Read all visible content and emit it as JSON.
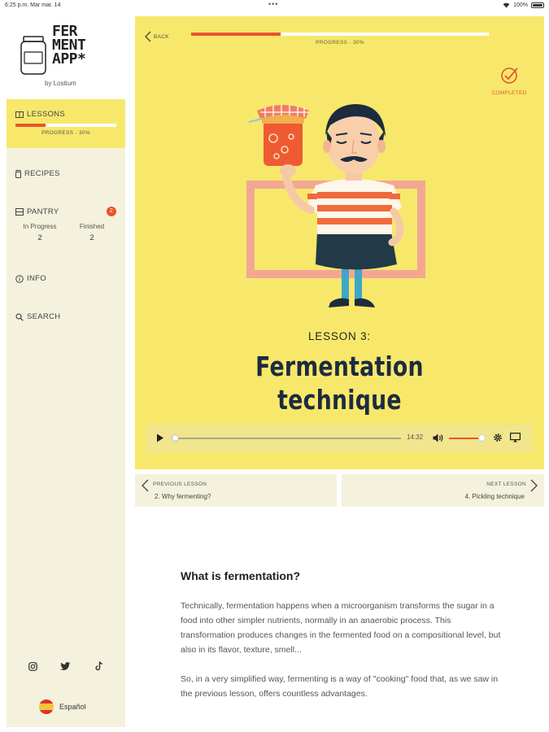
{
  "status_bar": {
    "time_date": "6:25 p.m.   Mar mar. 14",
    "dots": "•••",
    "battery": "100%"
  },
  "brand": {
    "logo_lines": [
      "FER",
      "MENT",
      "APP*"
    ],
    "byline": "by Lostium"
  },
  "sidebar": {
    "lessons": {
      "label": "LESSONS",
      "progress_text": "PROGRESS - 30%",
      "progress": 0.3
    },
    "recipes": {
      "label": "RECIPES"
    },
    "pantry": {
      "label": "PANTRY",
      "badge": "2",
      "in_progress_label": "In Progress",
      "in_progress_value": "2",
      "finished_label": "Finished",
      "finished_value": "2"
    },
    "info": {
      "label": "INFO"
    },
    "search": {
      "label": "SEARCH"
    },
    "socials": [
      "instagram-icon",
      "twitter-icon",
      "tiktok-icon"
    ],
    "language": "Español"
  },
  "hero": {
    "back_label": "BACK",
    "progress_text": "PROGRESS - 30%",
    "progress": 0.3,
    "completed_label": "COMPLETED",
    "lesson_number": "LESSON 3:",
    "title_line1": "Fermentation",
    "title_line2": "technique",
    "colors": {
      "background": "#f7e86c",
      "accent": "#e8542e",
      "title": "#1d2b3e"
    }
  },
  "player": {
    "time": "14:32",
    "position": 0,
    "volume": 0.9
  },
  "lesson_nav": {
    "previous_label": "PREVIOUS LESSON",
    "previous_name": "2. Why fermenting?",
    "next_label": "NEXT LESSON",
    "next_name": "4. Pickling technique"
  },
  "article": {
    "heading": "What is fermentation?",
    "paragraph1": "Technically, fermentation happens when a microorganism transforms the sugar in a food into other simpler nutrients, normally in an anaerobic process. This transformation produces changes in the fermented food on a compositional level, but also in its flavor, texture, smell...",
    "paragraph2": "So, in a very simplified way, fermenting is a way of \"cooking\" food that, as we saw in the previous lesson, offers countless advantages."
  }
}
